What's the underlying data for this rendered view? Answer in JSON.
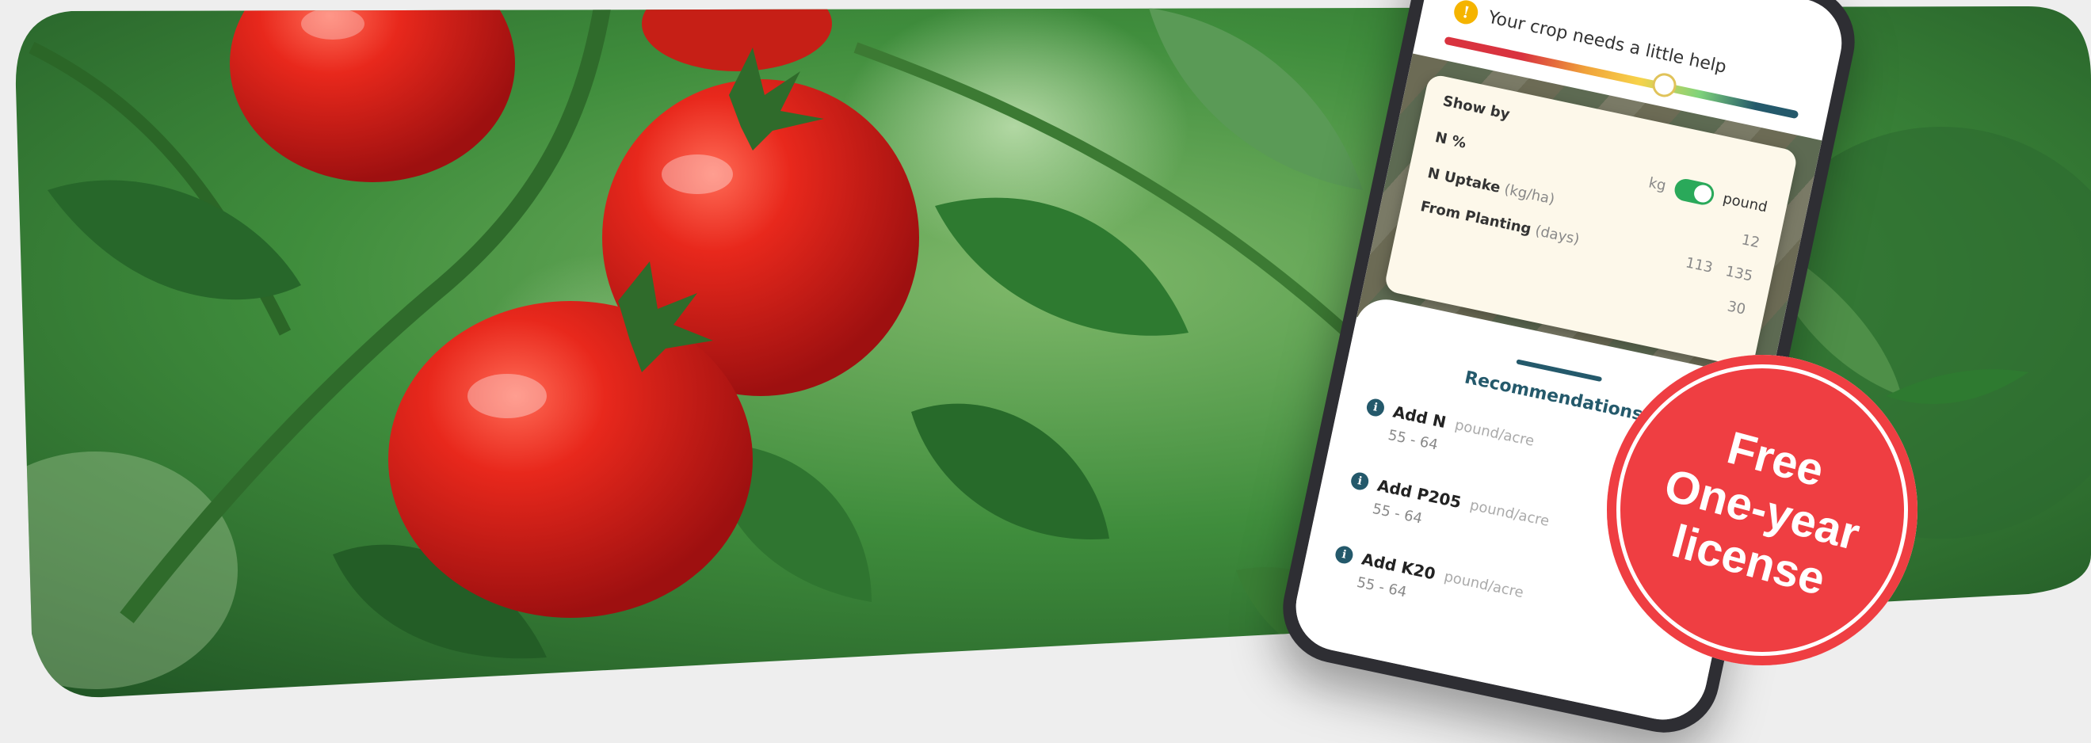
{
  "phone": {
    "alert_text": "Your crop needs a little help",
    "card": {
      "show_by_label": "Show by",
      "n_percent_label": "N %",
      "unit_left": "kg",
      "unit_right": "pound",
      "n_uptake_label": "N Uptake",
      "n_uptake_unit": "(kg/ha)",
      "n_uptake_value": "12",
      "from_planting_label": "From Planting",
      "from_planting_unit": "(days)",
      "from_planting_values": [
        "113",
        "135"
      ],
      "extra_value": "30"
    },
    "recommendations": {
      "title": "Recommendations",
      "items": [
        {
          "name": "Add N",
          "unit": "pound/acre",
          "range": "55 - 64"
        },
        {
          "name": "Add P205",
          "unit": "pound/acre",
          "range": "55 - 64"
        },
        {
          "name": "Add K20",
          "unit": "pound/acre",
          "range": "55 - 64"
        }
      ]
    },
    "status_level": 0.62
  },
  "badge": {
    "line1": "Free",
    "line2": "One-year",
    "line3": "license"
  },
  "colors": {
    "badge": "#ef3e42",
    "accent": "#24596b",
    "toggle": "#2aa95a",
    "leaf_dark": "#1f5a22",
    "tomato": "#d8241b"
  },
  "icons": [
    "warning-icon",
    "info-icon",
    "toggle-switch"
  ]
}
